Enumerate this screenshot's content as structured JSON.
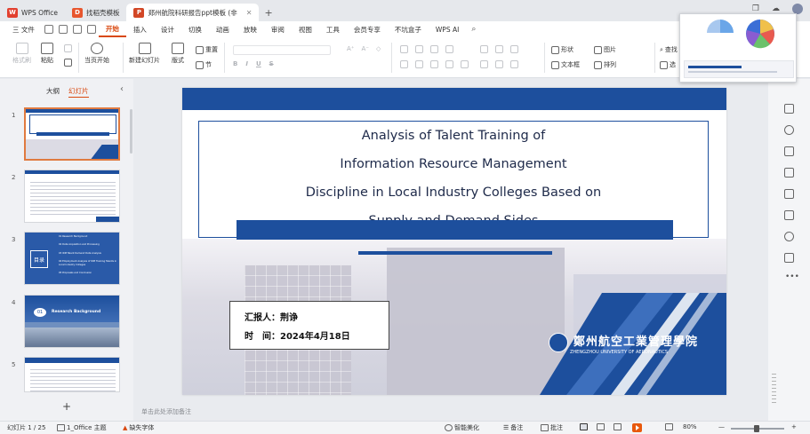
{
  "tabs": [
    {
      "label": "WPS Office",
      "logo": "W",
      "color": "#e2402f",
      "active": false
    },
    {
      "label": "找稻壳模板",
      "logo": "D",
      "color": "#e8562e",
      "active": false
    },
    {
      "label": "郑州航院科研报告ppt模板 (非",
      "logo": "P",
      "color": "#d24726",
      "active": true
    }
  ],
  "menu": {
    "file": "三 文件",
    "items": [
      "开始",
      "插入",
      "设计",
      "切换",
      "动画",
      "放映",
      "审阅",
      "视图",
      "工具",
      "会员专享",
      "不坑盒子",
      "WPS AI"
    ],
    "active_index": 0
  },
  "ribbon": {
    "format_painter": "格式刷",
    "paste": "粘贴",
    "start_from_current": "当页开始",
    "new_slide": "新建幻灯片",
    "layout": "版式",
    "section": "节",
    "reset": "重置",
    "shape": "形状",
    "picture": "图片",
    "textbox": "文本框",
    "arrange": "排列",
    "find": "查找",
    "select": "选"
  },
  "panel": {
    "tabs": [
      "大纲",
      "幻灯片"
    ],
    "active_tab": 1,
    "slide_numbers": [
      "1",
      "2",
      "3",
      "4",
      "5"
    ],
    "add_symbol": "+",
    "thumb3_items": [
      "01 Research Background",
      "02 Data Acquisition and Processing",
      "03 IRM Talent Demand Data Analysis",
      "04 Employment Analysis of IRM Training Talents in Local Industry Colleges",
      "05 Proposals and Conclusion"
    ],
    "thumb3_badge": "目录",
    "thumb4_num": "01",
    "thumb4_title": "Research Background"
  },
  "slide": {
    "title_lines": [
      "Analysis of Talent Training of",
      "Information Resource Management",
      "Discipline in Local Industry Colleges Based on",
      "Supply and Demand Sides"
    ],
    "reporter": "汇报人：荆诤",
    "date": "时　间：2024年4月18日",
    "university_cn": "鄭州航空工業管理學院",
    "university_en": "ZHENGZHOU UNIVERSITY OF AERONAUTICS"
  },
  "notes_placeholder": "单击此处添加备注",
  "status": {
    "slide_count": "幻灯片 1 / 25",
    "theme": "1_Office 主题",
    "missing_font": "缺失字体",
    "smart_beautify": "智能美化",
    "notes": "备注",
    "comments": "批注",
    "zoom": "80%"
  },
  "colors": {
    "accent": "#d9480f",
    "slide_blue": "#1d4f9d"
  }
}
